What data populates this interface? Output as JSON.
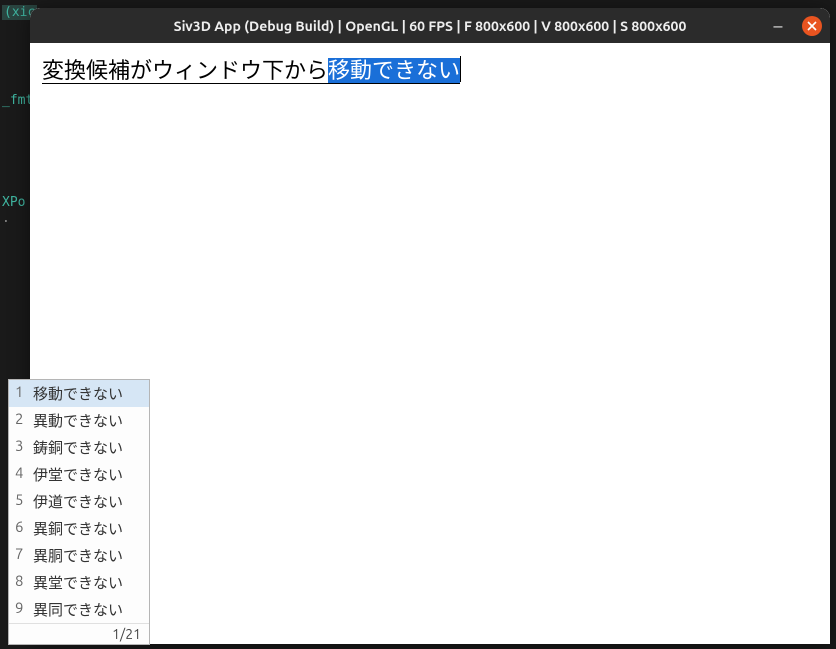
{
  "terminal": {
    "frag1": "(xic",
    "frag2": "_fmt",
    "frag3": "XPo",
    "frag4": "."
  },
  "window": {
    "title": "Siv3D App (Debug Build) | OpenGL | 60 FPS | F 800x600 | V 800x600 | S 800x600"
  },
  "ime": {
    "confirmed": "変換候補がウィンドウ下から",
    "converting": "移動できない"
  },
  "candidates": {
    "items": [
      {
        "n": "1",
        "text": "移動できない"
      },
      {
        "n": "2",
        "text": "異動できない"
      },
      {
        "n": "3",
        "text": "鋳銅できない"
      },
      {
        "n": "4",
        "text": "伊堂できない"
      },
      {
        "n": "5",
        "text": "伊道できない"
      },
      {
        "n": "6",
        "text": "異銅できない"
      },
      {
        "n": "7",
        "text": "異胴できない"
      },
      {
        "n": "8",
        "text": "異堂できない"
      },
      {
        "n": "9",
        "text": "異同できない"
      }
    ],
    "footer": "1/21"
  }
}
